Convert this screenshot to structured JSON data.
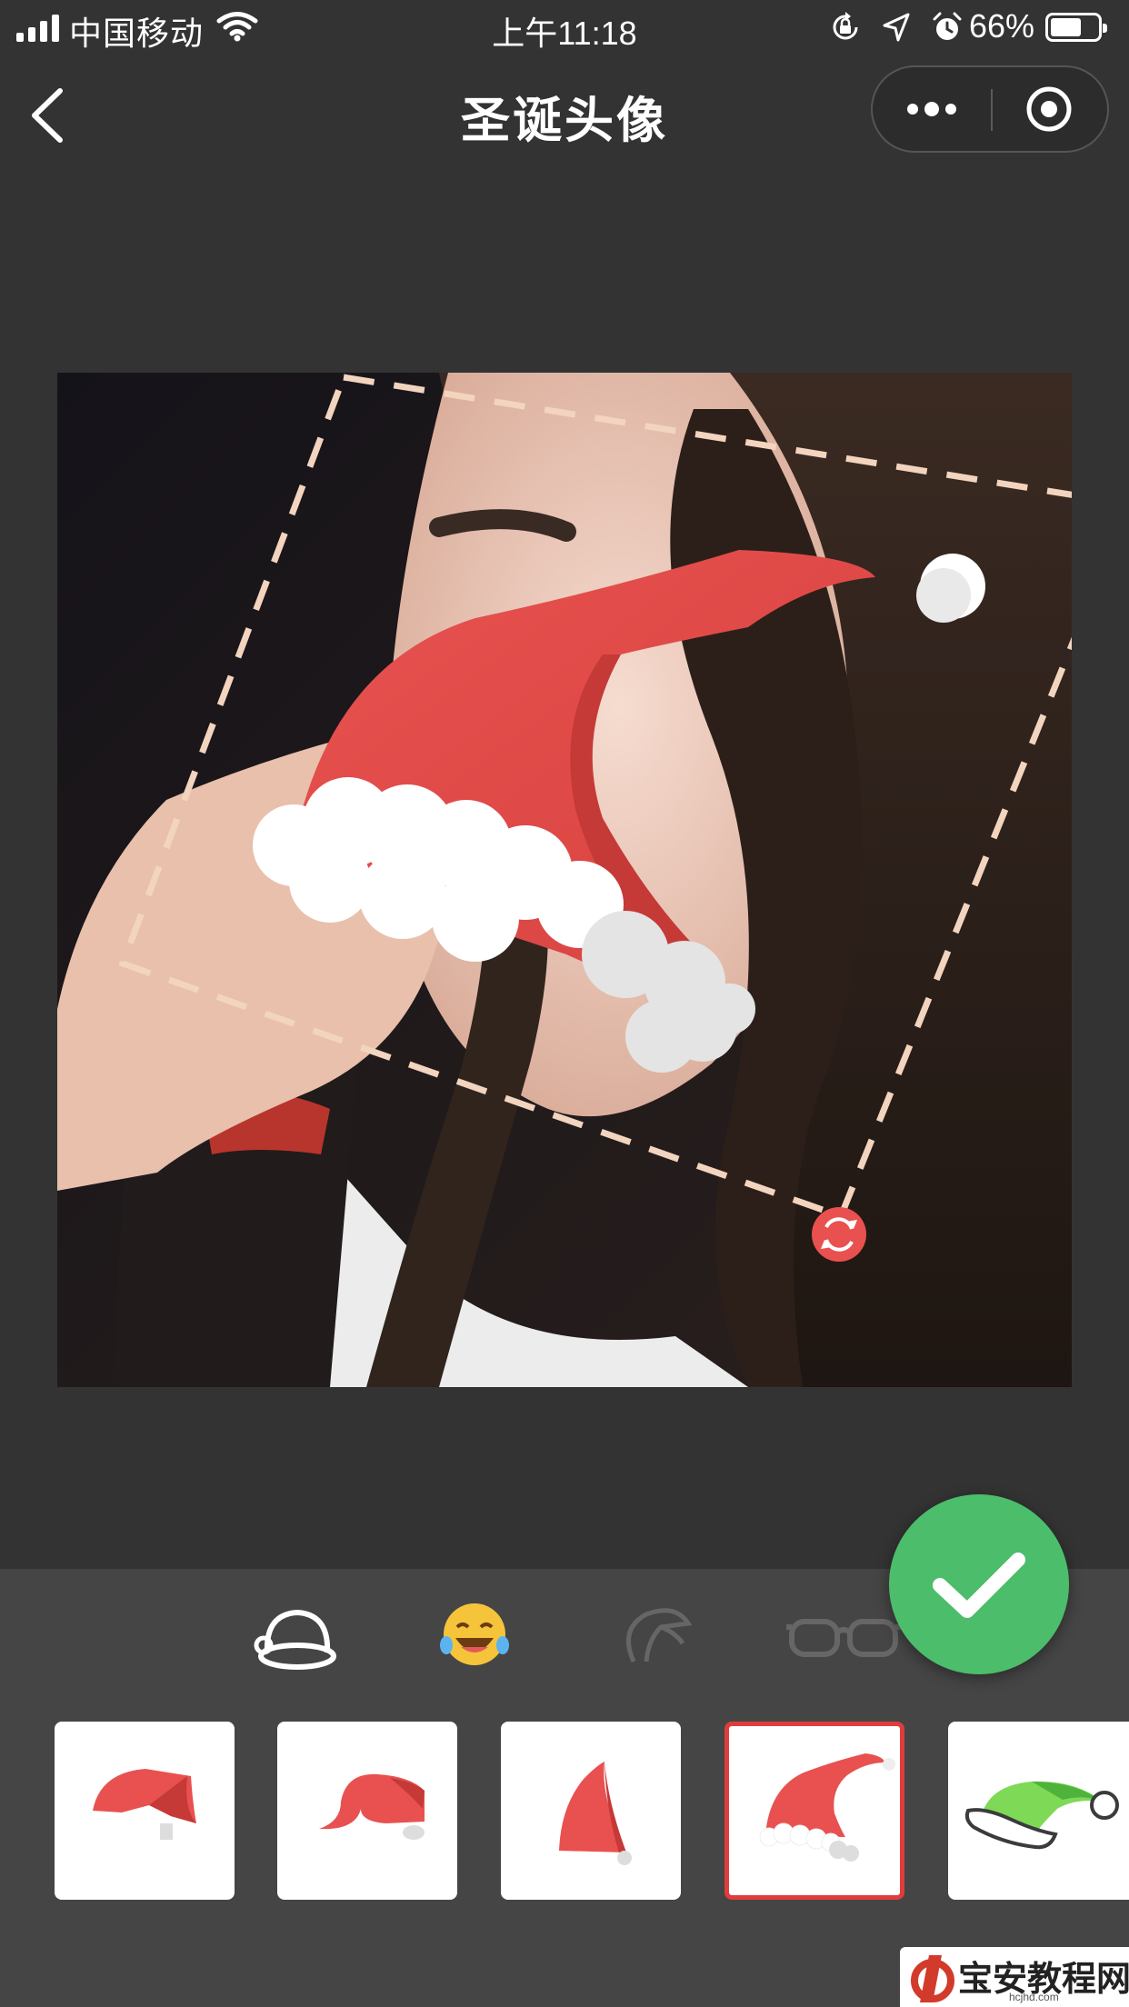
{
  "status_bar": {
    "carrier": "中国移动",
    "time": "上午11:18",
    "battery_percent": "66%",
    "battery_level": 0.66
  },
  "nav": {
    "title": "圣诞头像",
    "back_icon": "chevron-left-icon",
    "more_icon": "more-dots-icon",
    "close_icon": "target-circle-icon"
  },
  "editor": {
    "confirm_icon": "checkmark-icon",
    "rotate_handle_icon": "rotate-icon",
    "hat_color": "#e8514f",
    "frame_color": "#f2d4bf"
  },
  "categories": [
    {
      "name": "hat",
      "icon": "hat-icon",
      "active": true
    },
    {
      "name": "emoji",
      "icon": "emoji-laughing-icon",
      "active": false
    },
    {
      "name": "helmet",
      "icon": "helmet-icon",
      "active": false
    },
    {
      "name": "glasses",
      "icon": "glasses-icon",
      "active": false
    }
  ],
  "stickers": [
    {
      "icon": "santa-hat-flat-icon",
      "selected": false
    },
    {
      "icon": "santa-hat-wide-icon",
      "selected": false
    },
    {
      "icon": "santa-hat-tall-icon",
      "selected": false
    },
    {
      "icon": "santa-hat-curled-icon",
      "selected": true
    },
    {
      "icon": "green-hat-icon",
      "selected": false
    }
  ],
  "watermark": {
    "text": "宝安教程网",
    "sub": "hcjhd.com"
  }
}
